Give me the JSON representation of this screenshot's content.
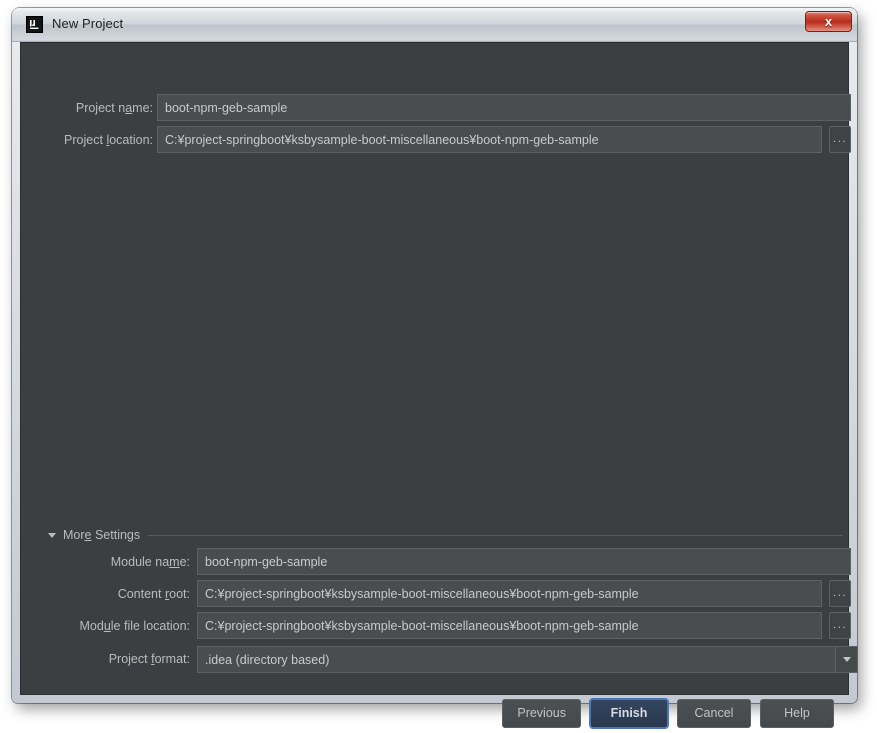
{
  "window": {
    "title": "New Project",
    "app_icon": "intellij-idea-icon",
    "close_label": "x"
  },
  "form": {
    "project_name": {
      "label_before": "Project n",
      "label_mnemonic": "a",
      "label_after": "me:",
      "value": "boot-npm-geb-sample"
    },
    "project_location": {
      "label_before": "Project ",
      "label_mnemonic": "l",
      "label_after": "ocation:",
      "value": "C:¥project-springboot¥ksbysample-boot-miscellaneous¥boot-npm-geb-sample",
      "browse_label": "..."
    }
  },
  "more_settings": {
    "label": "More Settings",
    "label_before": "Mor",
    "label_mnemonic": "e",
    "label_after": " Settings",
    "expanded": true,
    "module_name": {
      "label_before": "Module na",
      "label_mnemonic": "m",
      "label_after": "e:",
      "value": "boot-npm-geb-sample"
    },
    "content_root": {
      "label_before": "Content ",
      "label_mnemonic": "r",
      "label_after": "oot:",
      "value": "C:¥project-springboot¥ksbysample-boot-miscellaneous¥boot-npm-geb-sample",
      "browse_label": "..."
    },
    "module_file_location": {
      "label_before": "Mod",
      "label_mnemonic": "u",
      "label_after": "le file location:",
      "value": "C:¥project-springboot¥ksbysample-boot-miscellaneous¥boot-npm-geb-sample",
      "browse_label": "..."
    },
    "project_format": {
      "label_before": "Project ",
      "label_mnemonic": "f",
      "label_after": "ormat:",
      "value": ".idea (directory based)"
    }
  },
  "buttons": {
    "previous": "Previous",
    "finish": "Finish",
    "cancel": "Cancel",
    "help": "Help"
  },
  "colors": {
    "panel_bg": "#3c3f41",
    "field_bg": "#4a4d4e",
    "text": "#b8bcbd",
    "default_button_border": "#4a77b8",
    "close_button": "#b62d1c"
  }
}
